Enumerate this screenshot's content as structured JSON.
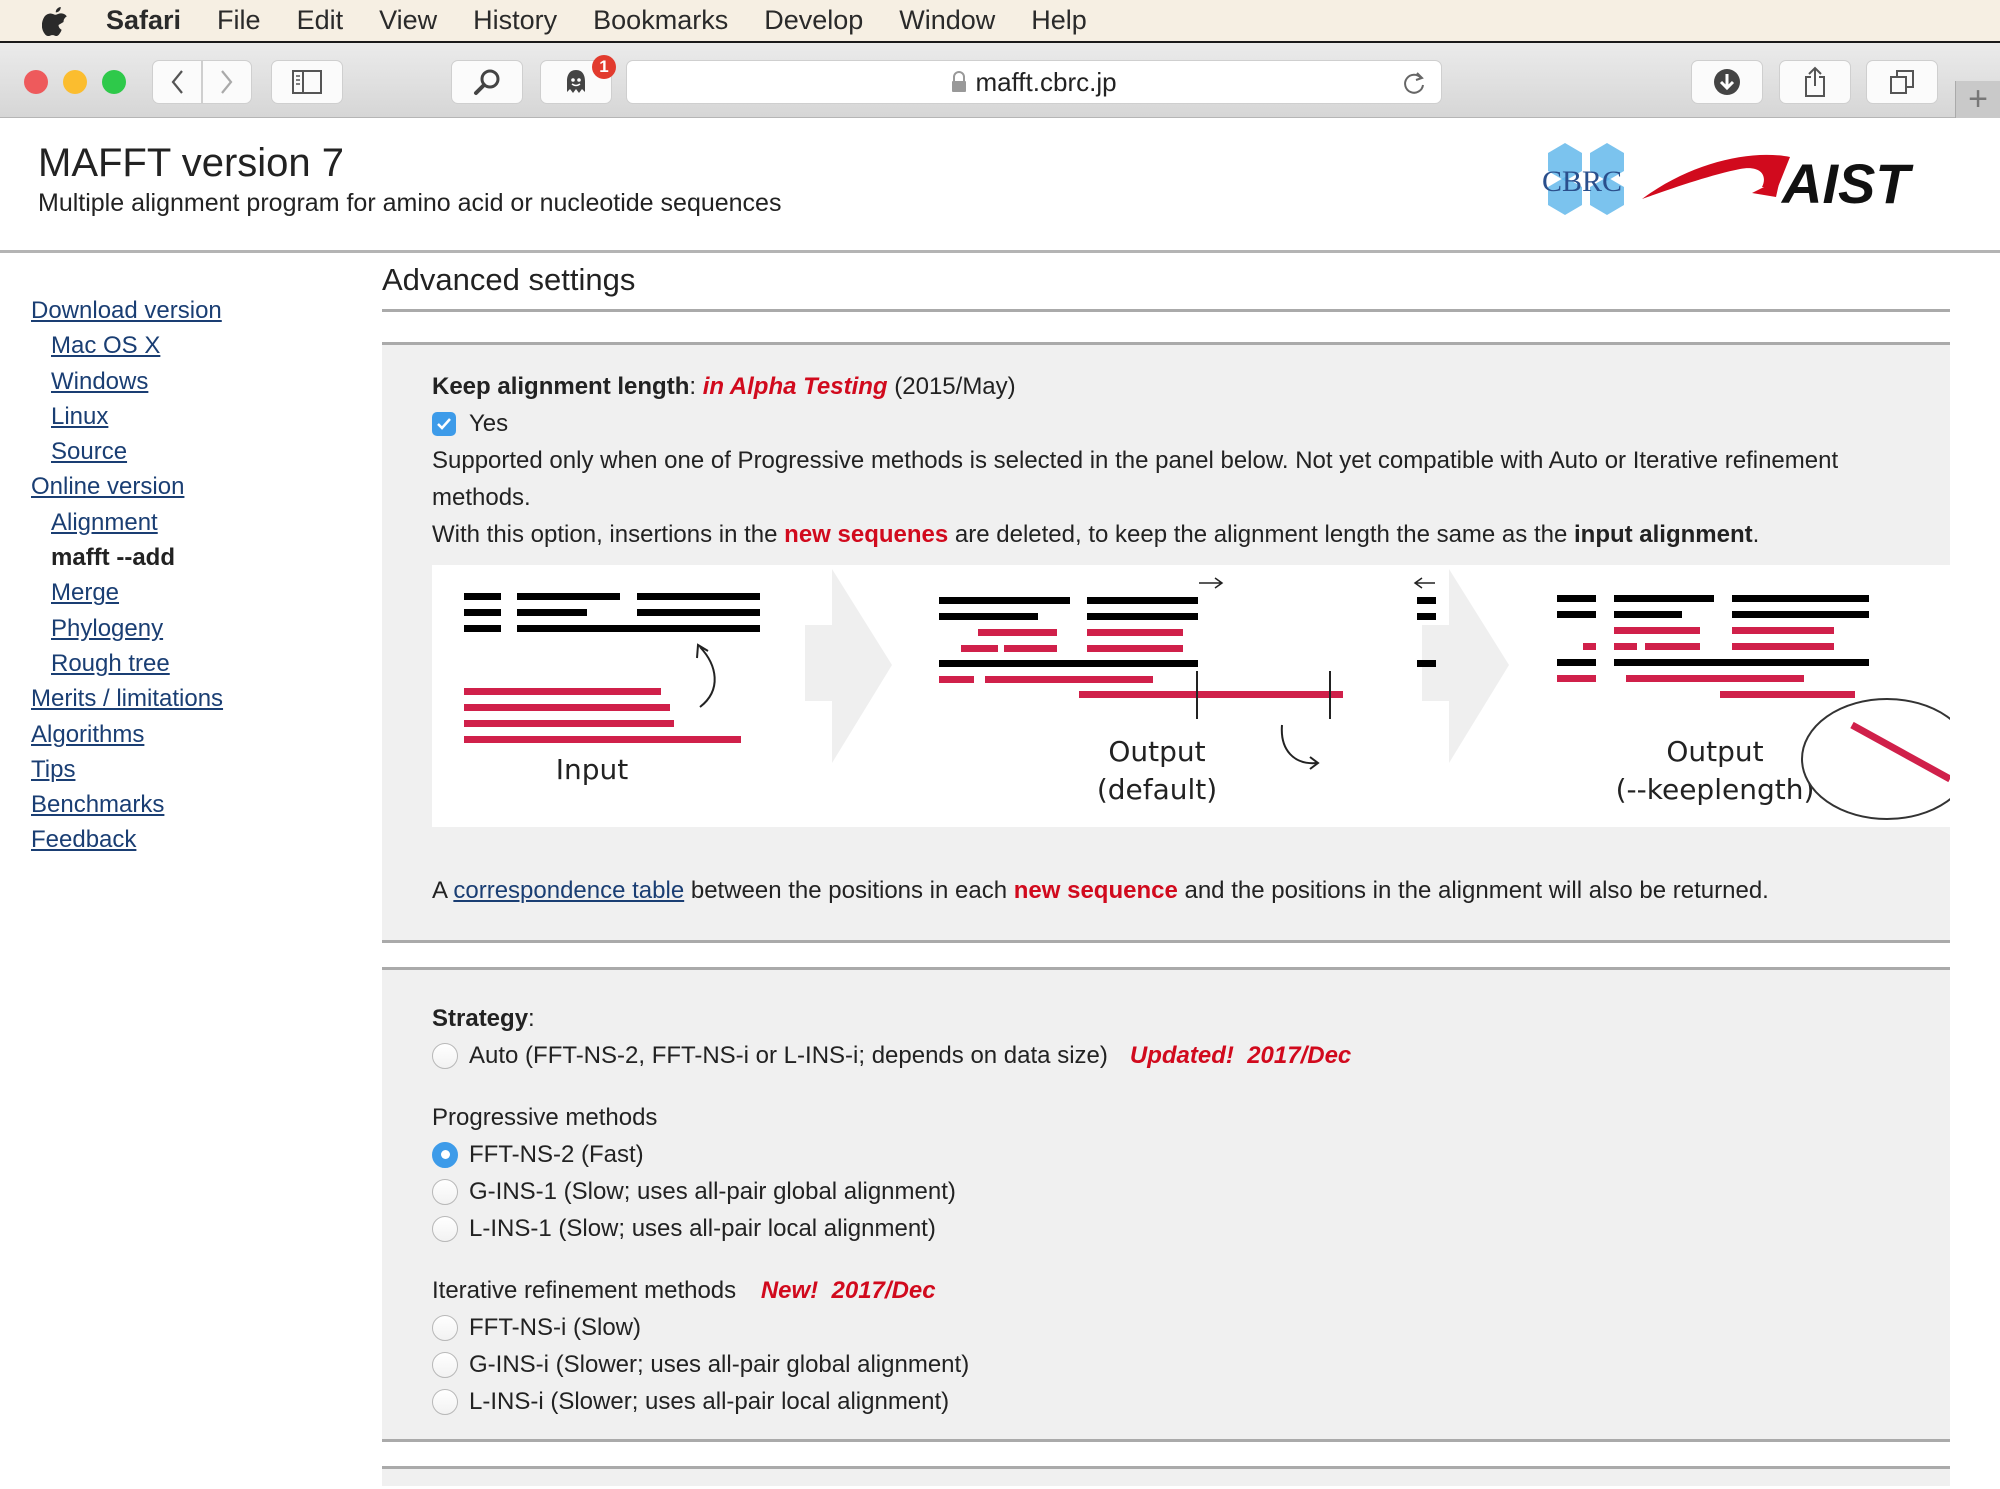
{
  "menubar": {
    "app": "Safari",
    "items": [
      "File",
      "Edit",
      "View",
      "History",
      "Bookmarks",
      "Develop",
      "Window",
      "Help"
    ]
  },
  "toolbar": {
    "url": "mafft.cbrc.jp",
    "notification_badge": "1"
  },
  "header": {
    "title": "MAFFT version 7",
    "subtitle": "Multiple alignment program for amino acid or nucleotide sequences",
    "logo_cbrc": "CBRC",
    "logo_aist": "AIST"
  },
  "sidebar": {
    "items": [
      {
        "label": "Download version",
        "level": 0
      },
      {
        "label": "Mac OS X",
        "level": 1
      },
      {
        "label": "Windows",
        "level": 1
      },
      {
        "label": "Linux",
        "level": 1
      },
      {
        "label": "Source",
        "level": 1
      },
      {
        "label": "Online version",
        "level": 0
      },
      {
        "label": "Alignment",
        "level": 1
      },
      {
        "label": "mafft --add",
        "level": 1,
        "current": true
      },
      {
        "label": "Merge",
        "level": 1
      },
      {
        "label": "Phylogeny",
        "level": 1
      },
      {
        "label": "Rough tree",
        "level": 1
      },
      {
        "label": "Merits / limitations",
        "level": 0
      },
      {
        "label": "Algorithms",
        "level": 0
      },
      {
        "label": "Tips",
        "level": 0
      },
      {
        "label": "Benchmarks",
        "level": 0
      },
      {
        "label": "Feedback",
        "level": 0
      }
    ]
  },
  "main": {
    "section_title": "Advanced settings",
    "keep_length": {
      "label": "Keep alignment length",
      "colon": ":",
      "status": "in Alpha Testing",
      "date": "(2015/May)",
      "checkbox_label": "Yes",
      "checked": true,
      "note1": "Supported only when one of Progressive methods is selected in the panel below.   Not yet compatible with Auto or Iterative refinement methods.",
      "note2_pre": "With this option, insertions in the ",
      "note2_red": "new sequenes",
      "note2_mid": " are deleted, to keep the alignment length the same as the ",
      "note2_bold": "input alignment",
      "note2_post": ".",
      "diagram": {
        "label_input": "Input",
        "label_output_default_1": "Output",
        "label_output_default_2": "(default)",
        "label_output_keep_1": "Output",
        "label_output_keep_2": "(--keeplength)"
      },
      "corr_pre": "A ",
      "corr_link": "correspondence table",
      "corr_mid": " between the positions in each ",
      "corr_red": "new sequence",
      "corr_post": " and the positions in the alignment will also be returned."
    },
    "strategy": {
      "label": "Strategy",
      "colon": ":",
      "auto": {
        "label": "Auto (FFT-NS-2, FFT-NS-i or L-INS-i; depends on data size)",
        "tag": "Updated!  2017/Dec",
        "selected": false
      },
      "progressive_heading": "Progressive methods",
      "progressive": [
        {
          "label": "FFT-NS-2 (Fast)",
          "selected": true
        },
        {
          "label": "G-INS-1 (Slow; uses all-pair global alignment)",
          "selected": false
        },
        {
          "label": "L-INS-1 (Slow; uses all-pair local alignment)",
          "selected": false
        }
      ],
      "iterative_heading": "Iterative refinement methods",
      "iterative_tag": "New!  2017/Dec",
      "iterative": [
        {
          "label": "FFT-NS-i (Slow)",
          "selected": false
        },
        {
          "label": "G-INS-i (Slower; uses all-pair global alignment)",
          "selected": false
        },
        {
          "label": "L-INS-i (Slower; uses all-pair local alignment)",
          "selected": false
        }
      ]
    }
  },
  "colors": {
    "accent_red": "#d10a1d",
    "diagram_red": "#d0204a",
    "link_blue": "#1a3e73",
    "control_blue": "#3d9be9",
    "panel_bg": "#f0f0f0"
  }
}
